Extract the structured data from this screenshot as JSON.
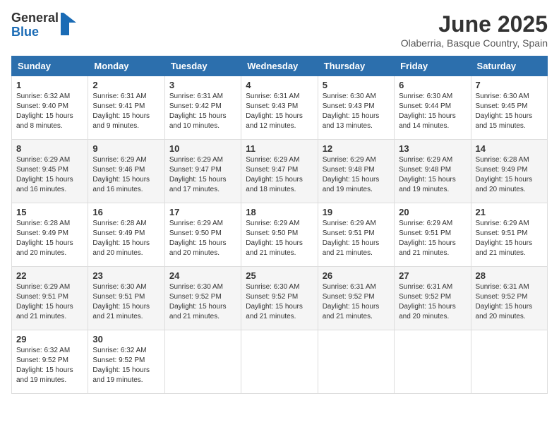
{
  "logo": {
    "general": "General",
    "blue": "Blue"
  },
  "title": "June 2025",
  "location": "Olaberria, Basque Country, Spain",
  "headers": [
    "Sunday",
    "Monday",
    "Tuesday",
    "Wednesday",
    "Thursday",
    "Friday",
    "Saturday"
  ],
  "weeks": [
    [
      {
        "day": "1",
        "info": "Sunrise: 6:32 AM\nSunset: 9:40 PM\nDaylight: 15 hours\nand 8 minutes."
      },
      {
        "day": "2",
        "info": "Sunrise: 6:31 AM\nSunset: 9:41 PM\nDaylight: 15 hours\nand 9 minutes."
      },
      {
        "day": "3",
        "info": "Sunrise: 6:31 AM\nSunset: 9:42 PM\nDaylight: 15 hours\nand 10 minutes."
      },
      {
        "day": "4",
        "info": "Sunrise: 6:31 AM\nSunset: 9:43 PM\nDaylight: 15 hours\nand 12 minutes."
      },
      {
        "day": "5",
        "info": "Sunrise: 6:30 AM\nSunset: 9:43 PM\nDaylight: 15 hours\nand 13 minutes."
      },
      {
        "day": "6",
        "info": "Sunrise: 6:30 AM\nSunset: 9:44 PM\nDaylight: 15 hours\nand 14 minutes."
      },
      {
        "day": "7",
        "info": "Sunrise: 6:30 AM\nSunset: 9:45 PM\nDaylight: 15 hours\nand 15 minutes."
      }
    ],
    [
      {
        "day": "8",
        "info": "Sunrise: 6:29 AM\nSunset: 9:45 PM\nDaylight: 15 hours\nand 16 minutes."
      },
      {
        "day": "9",
        "info": "Sunrise: 6:29 AM\nSunset: 9:46 PM\nDaylight: 15 hours\nand 16 minutes."
      },
      {
        "day": "10",
        "info": "Sunrise: 6:29 AM\nSunset: 9:47 PM\nDaylight: 15 hours\nand 17 minutes."
      },
      {
        "day": "11",
        "info": "Sunrise: 6:29 AM\nSunset: 9:47 PM\nDaylight: 15 hours\nand 18 minutes."
      },
      {
        "day": "12",
        "info": "Sunrise: 6:29 AM\nSunset: 9:48 PM\nDaylight: 15 hours\nand 19 minutes."
      },
      {
        "day": "13",
        "info": "Sunrise: 6:29 AM\nSunset: 9:48 PM\nDaylight: 15 hours\nand 19 minutes."
      },
      {
        "day": "14",
        "info": "Sunrise: 6:28 AM\nSunset: 9:49 PM\nDaylight: 15 hours\nand 20 minutes."
      }
    ],
    [
      {
        "day": "15",
        "info": "Sunrise: 6:28 AM\nSunset: 9:49 PM\nDaylight: 15 hours\nand 20 minutes."
      },
      {
        "day": "16",
        "info": "Sunrise: 6:28 AM\nSunset: 9:49 PM\nDaylight: 15 hours\nand 20 minutes."
      },
      {
        "day": "17",
        "info": "Sunrise: 6:29 AM\nSunset: 9:50 PM\nDaylight: 15 hours\nand 20 minutes."
      },
      {
        "day": "18",
        "info": "Sunrise: 6:29 AM\nSunset: 9:50 PM\nDaylight: 15 hours\nand 21 minutes."
      },
      {
        "day": "19",
        "info": "Sunrise: 6:29 AM\nSunset: 9:51 PM\nDaylight: 15 hours\nand 21 minutes."
      },
      {
        "day": "20",
        "info": "Sunrise: 6:29 AM\nSunset: 9:51 PM\nDaylight: 15 hours\nand 21 minutes."
      },
      {
        "day": "21",
        "info": "Sunrise: 6:29 AM\nSunset: 9:51 PM\nDaylight: 15 hours\nand 21 minutes."
      }
    ],
    [
      {
        "day": "22",
        "info": "Sunrise: 6:29 AM\nSunset: 9:51 PM\nDaylight: 15 hours\nand 21 minutes."
      },
      {
        "day": "23",
        "info": "Sunrise: 6:30 AM\nSunset: 9:51 PM\nDaylight: 15 hours\nand 21 minutes."
      },
      {
        "day": "24",
        "info": "Sunrise: 6:30 AM\nSunset: 9:52 PM\nDaylight: 15 hours\nand 21 minutes."
      },
      {
        "day": "25",
        "info": "Sunrise: 6:30 AM\nSunset: 9:52 PM\nDaylight: 15 hours\nand 21 minutes."
      },
      {
        "day": "26",
        "info": "Sunrise: 6:31 AM\nSunset: 9:52 PM\nDaylight: 15 hours\nand 21 minutes."
      },
      {
        "day": "27",
        "info": "Sunrise: 6:31 AM\nSunset: 9:52 PM\nDaylight: 15 hours\nand 20 minutes."
      },
      {
        "day": "28",
        "info": "Sunrise: 6:31 AM\nSunset: 9:52 PM\nDaylight: 15 hours\nand 20 minutes."
      }
    ],
    [
      {
        "day": "29",
        "info": "Sunrise: 6:32 AM\nSunset: 9:52 PM\nDaylight: 15 hours\nand 19 minutes."
      },
      {
        "day": "30",
        "info": "Sunrise: 6:32 AM\nSunset: 9:52 PM\nDaylight: 15 hours\nand 19 minutes."
      },
      {
        "day": "",
        "info": ""
      },
      {
        "day": "",
        "info": ""
      },
      {
        "day": "",
        "info": ""
      },
      {
        "day": "",
        "info": ""
      },
      {
        "day": "",
        "info": ""
      }
    ]
  ]
}
